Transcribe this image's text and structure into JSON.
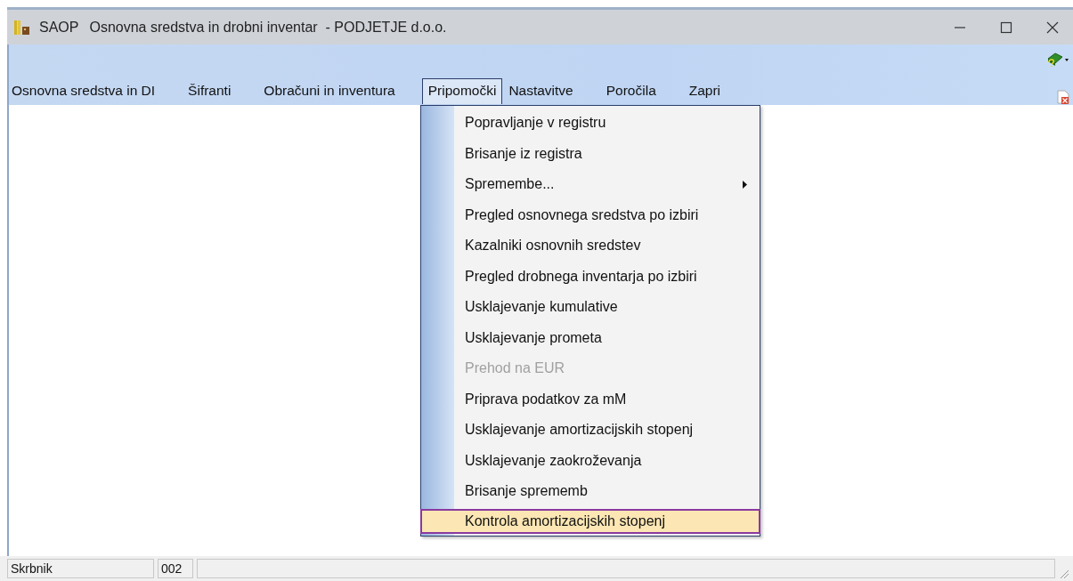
{
  "window": {
    "app_name": "SAOP",
    "title": "Osnovna sredstva in drobni inventar  - PODJETJE d.o.o."
  },
  "menu_bar": [
    {
      "label": "Osnovna sredstva in DI",
      "selected": false
    },
    {
      "label": "Šifranti",
      "selected": false
    },
    {
      "label": "Obračuni in inventura",
      "selected": false
    },
    {
      "label": "Pripomočki",
      "selected": true
    },
    {
      "label": "Nastavitve",
      "selected": false
    },
    {
      "label": "Poročila",
      "selected": false
    },
    {
      "label": "Zapri",
      "selected": false
    }
  ],
  "dropdown": {
    "items": [
      {
        "label": "Popravljanje v registru",
        "disabled": false,
        "submenu": false,
        "selected": false
      },
      {
        "label": "Brisanje iz registra",
        "disabled": false,
        "submenu": false,
        "selected": false
      },
      {
        "label": "Spremembe...",
        "disabled": false,
        "submenu": true,
        "selected": false
      },
      {
        "label": "Pregled osnovnega sredstva po izbiri",
        "disabled": false,
        "submenu": false,
        "selected": false
      },
      {
        "label": "Kazalniki osnovnih sredstev",
        "disabled": false,
        "submenu": false,
        "selected": false
      },
      {
        "label": "Pregled drobnega inventarja po izbiri",
        "disabled": false,
        "submenu": false,
        "selected": false
      },
      {
        "label": "Usklajevanje kumulative",
        "disabled": false,
        "submenu": false,
        "selected": false
      },
      {
        "label": "Usklajevanje prometa",
        "disabled": false,
        "submenu": false,
        "selected": false
      },
      {
        "label": "Prehod na EUR",
        "disabled": true,
        "submenu": false,
        "selected": false
      },
      {
        "label": "Priprava podatkov za mM",
        "disabled": false,
        "submenu": false,
        "selected": false
      },
      {
        "label": "Usklajevanje amortizacijskih stopenj",
        "disabled": false,
        "submenu": false,
        "selected": false
      },
      {
        "label": "Usklajevanje zaokroževanja",
        "disabled": false,
        "submenu": false,
        "selected": false
      },
      {
        "label": "Brisanje sprememb",
        "disabled": false,
        "submenu": false,
        "selected": false
      },
      {
        "label": "Kontrola amortizacijskih stopenj",
        "disabled": false,
        "submenu": false,
        "selected": true
      }
    ]
  },
  "status_bar": {
    "user": "Skrbnik",
    "code": "002"
  }
}
